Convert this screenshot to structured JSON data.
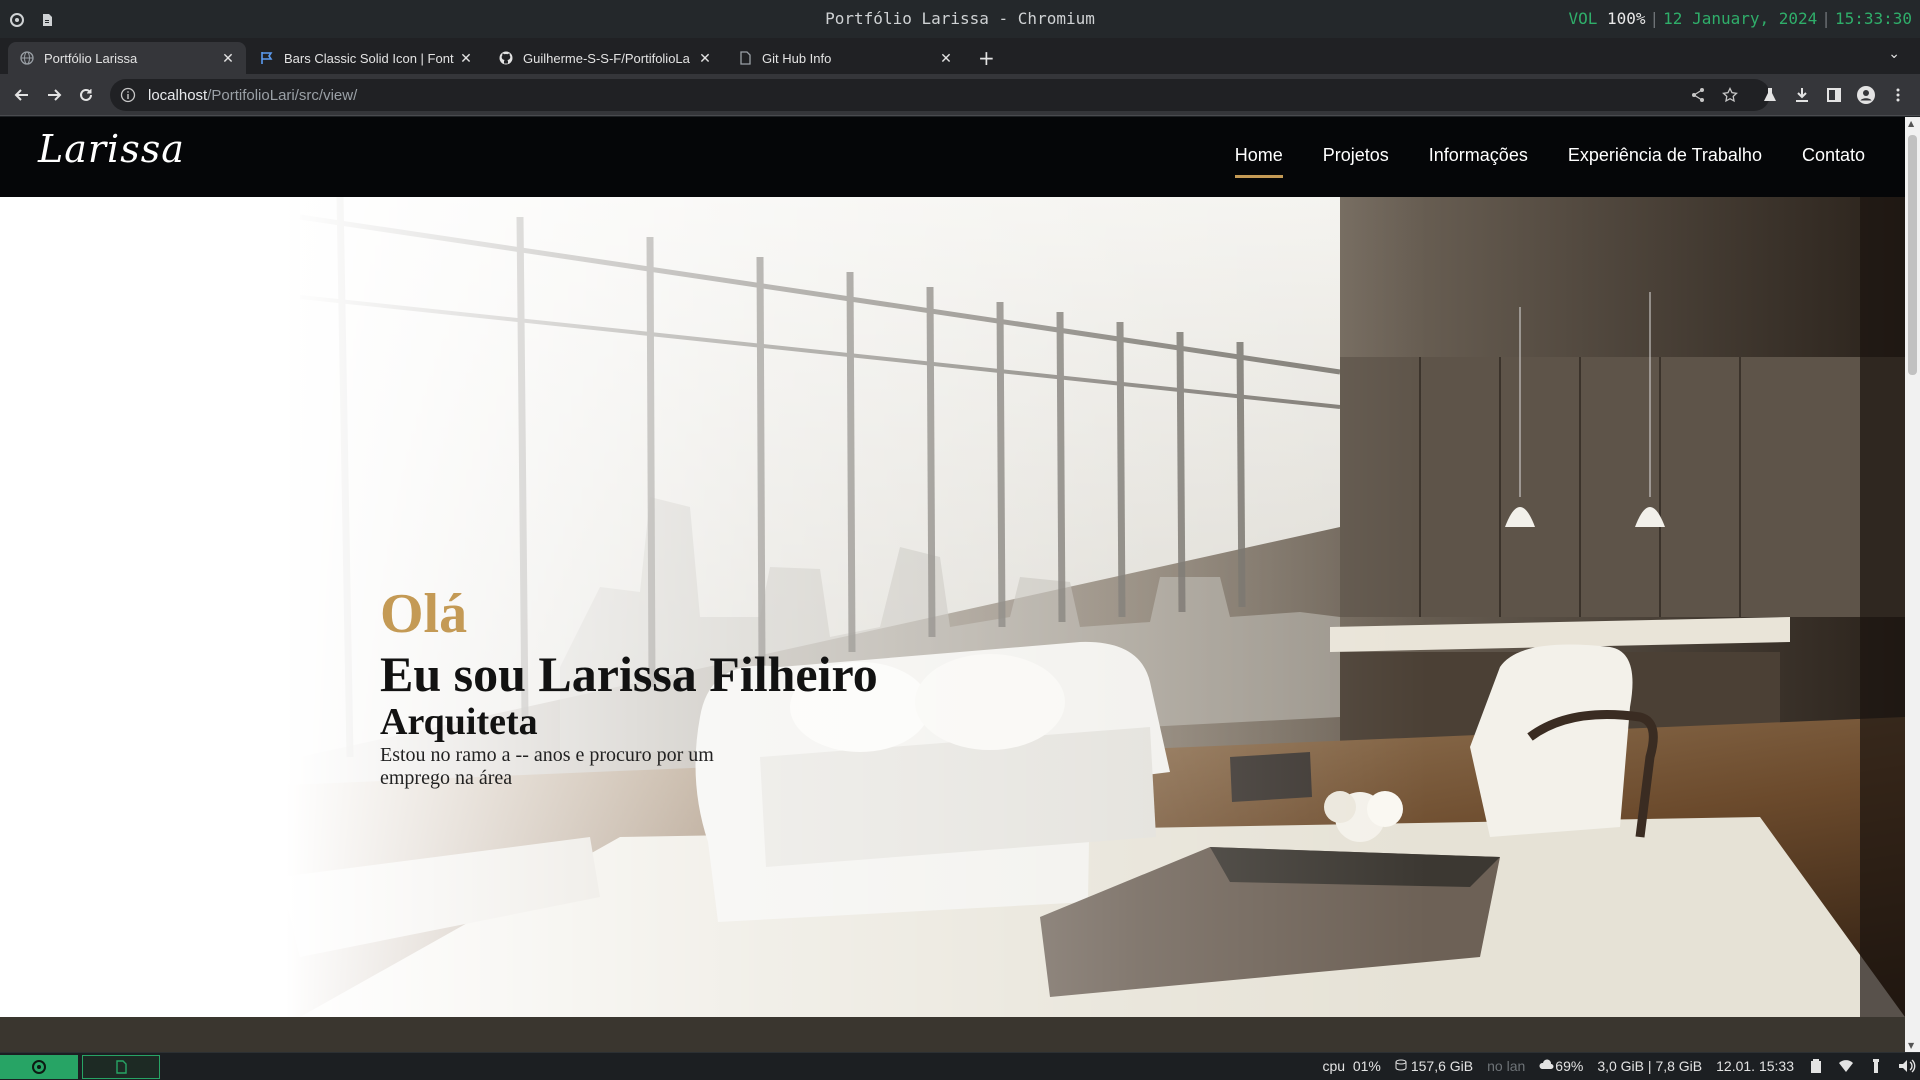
{
  "window": {
    "title": "Portfólio Larissa - Chromium",
    "status": {
      "vol_label": "VOL",
      "vol_value": "100%",
      "date": "12 January, 2024",
      "time": "15:33:30"
    }
  },
  "tabs": [
    {
      "title": "Portfólio Larissa",
      "icon": "globe-icon",
      "active": true
    },
    {
      "title": "Bars Classic Solid Icon | Font",
      "icon": "flag-icon",
      "active": false
    },
    {
      "title": "Guilherme-S-S-F/PortifolioLa",
      "icon": "github-icon",
      "active": false
    },
    {
      "title": "Git Hub Info",
      "icon": "document-icon",
      "active": false
    }
  ],
  "omnibox": {
    "host": "localhost",
    "path": "/PortifolioLari/src/view/"
  },
  "site": {
    "logo": "Larissa",
    "nav": [
      "Home",
      "Projetos",
      "Informações",
      "Experiência de Trabalho",
      "Contato"
    ],
    "active_nav": "Home",
    "accent": "#c49a55",
    "hero": {
      "greeting": "Olá",
      "name": "Eu sou Larissa Filheiro",
      "role": "Arquiteta",
      "description": "Estou no ramo a -- anos e procuro por um emprego na área"
    }
  },
  "panel": {
    "cpu_label": "cpu",
    "cpu_value": "01%",
    "disk": "157,6 GiB",
    "network": "no lan",
    "mem_pct": "69%",
    "mem_used": "3,0 GiB",
    "mem_total": "7,8 GiB",
    "clock": "12.01. 15:33"
  }
}
